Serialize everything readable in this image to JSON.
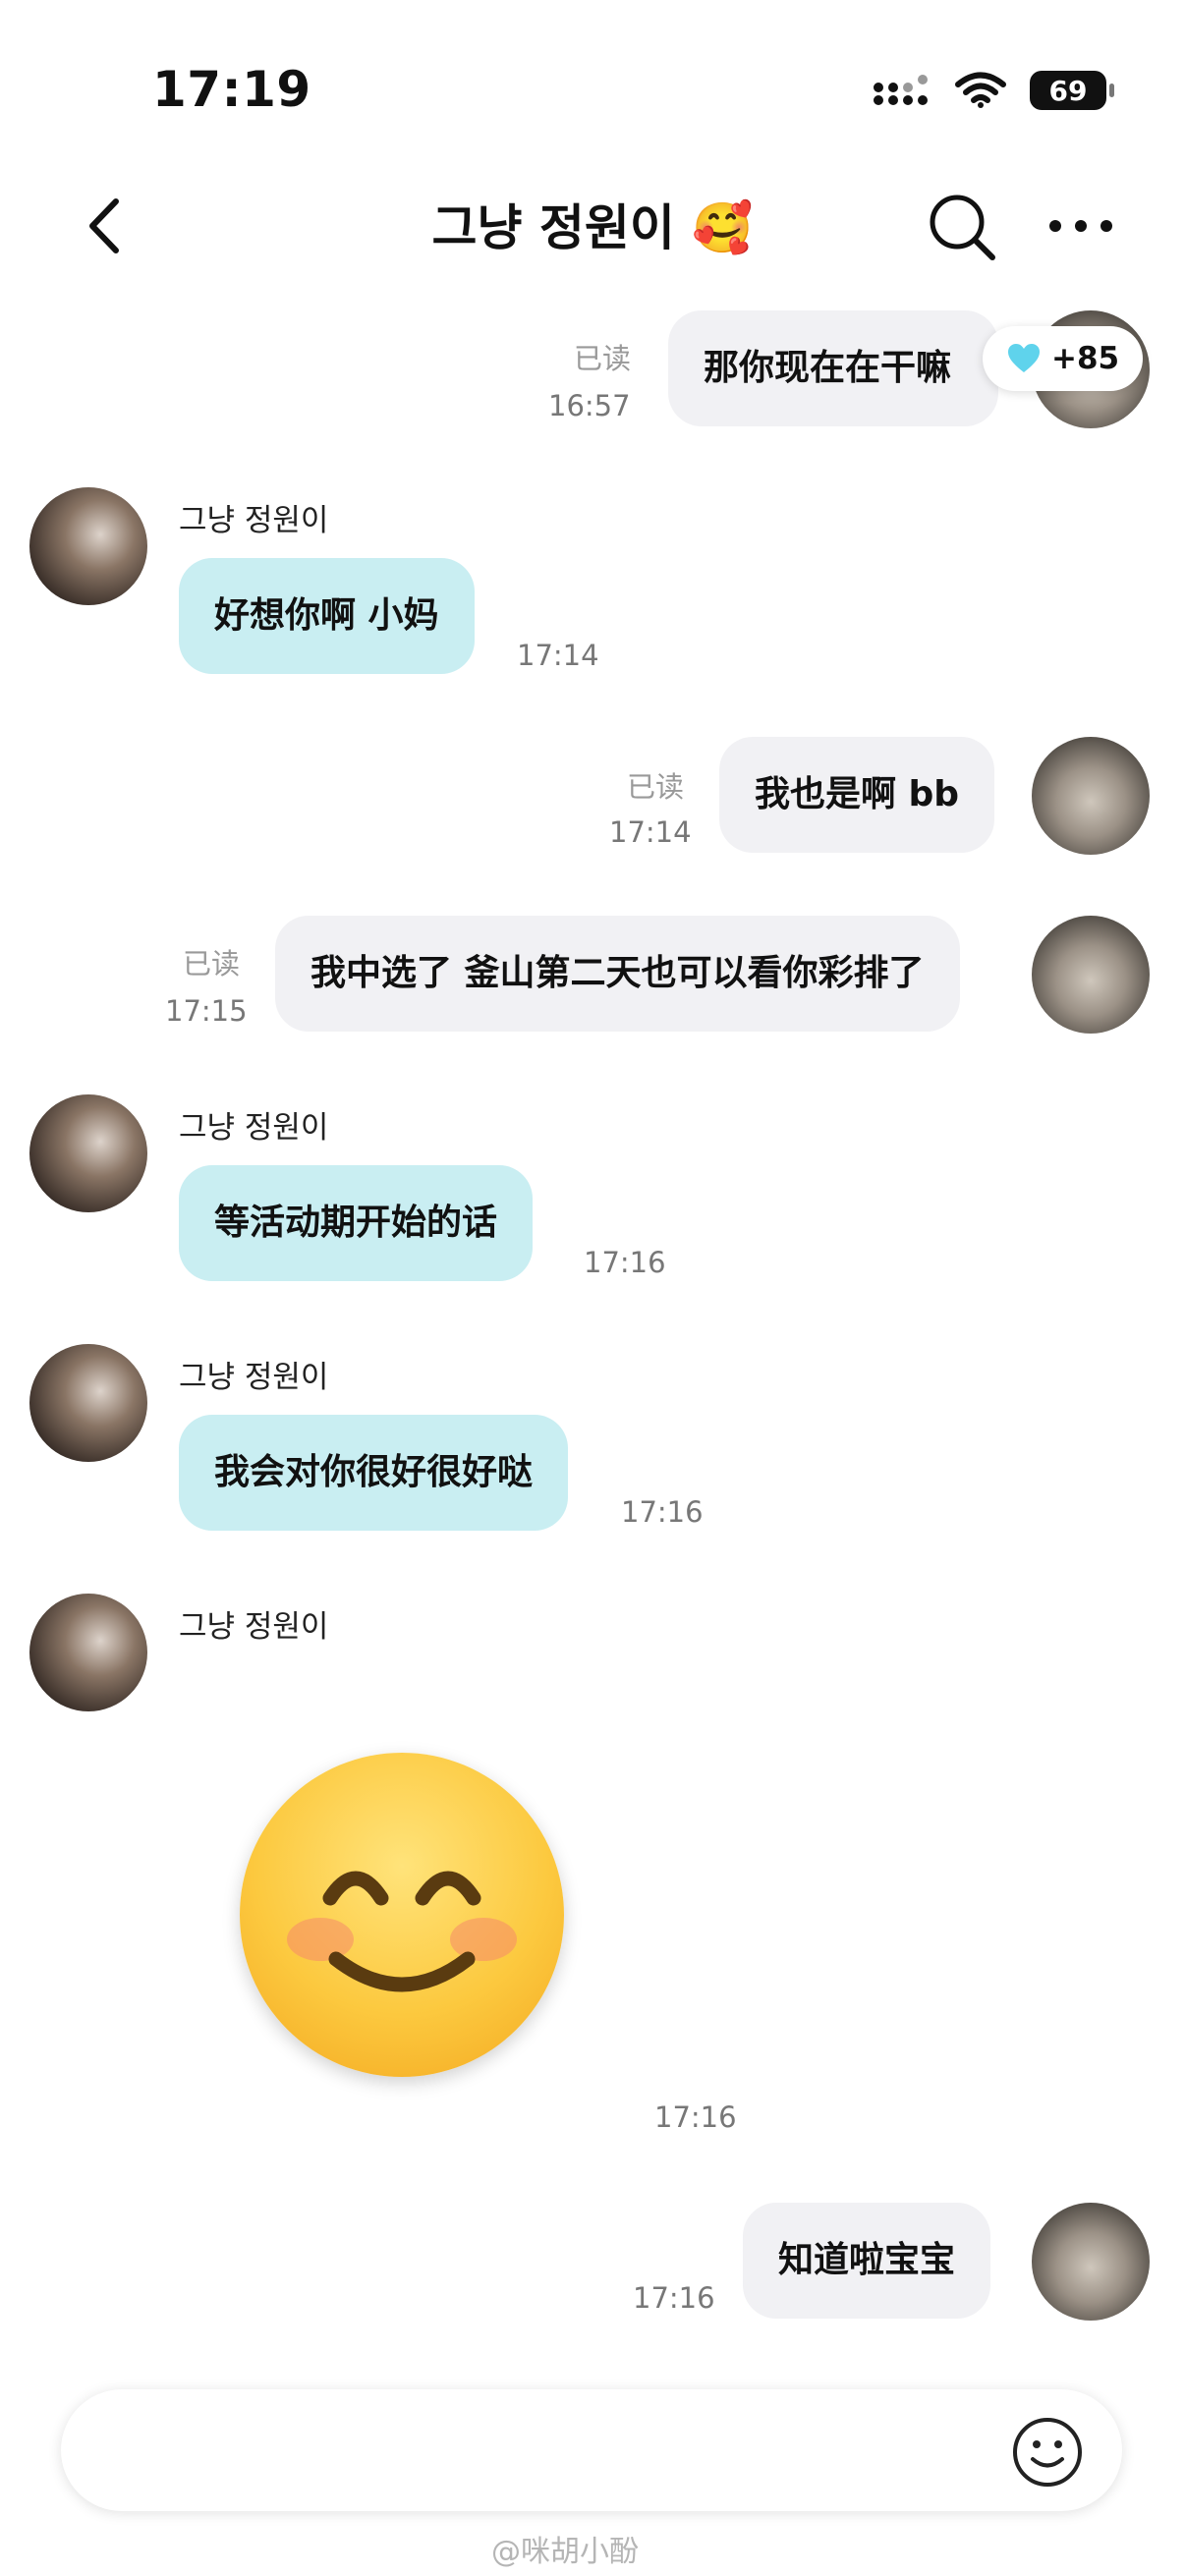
{
  "status_bar": {
    "time": "17:19",
    "battery": "69"
  },
  "header": {
    "title": "그냥 정원이 🥰"
  },
  "messages": [
    {
      "dir": "out",
      "text": "那你现在在干嘛",
      "time": "16:57",
      "read": "已读",
      "reaction": "+85"
    },
    {
      "dir": "in",
      "sender": "그냥 정원이",
      "text": "好想你啊 小妈",
      "time": "17:14"
    },
    {
      "dir": "out",
      "text": "我也是啊 bb",
      "time": "17:14",
      "read": "已读"
    },
    {
      "dir": "out",
      "text": "我中选了 釜山第二天也可以看你彩排了",
      "time": "17:15",
      "read": "已读"
    },
    {
      "dir": "in",
      "sender": "그냥 정원이",
      "text": "等活动期开始的话",
      "time": "17:16"
    },
    {
      "dir": "in",
      "sender": "그냥 정원이",
      "text": "我会对你很好很好哒",
      "time": "17:16"
    },
    {
      "dir": "in",
      "sender": "그냥 정원이",
      "text": "",
      "time": "17:16",
      "sticker": "smiling-face-emoji"
    },
    {
      "dir": "out",
      "text": "知道啦宝宝",
      "time": "17:16"
    }
  ],
  "watermark": "@咪胡小酚",
  "colors": {
    "incoming_bubble": "#c9eef2",
    "outgoing_bubble": "#f1f1f4",
    "reaction_heart": "#5fd3ec"
  }
}
